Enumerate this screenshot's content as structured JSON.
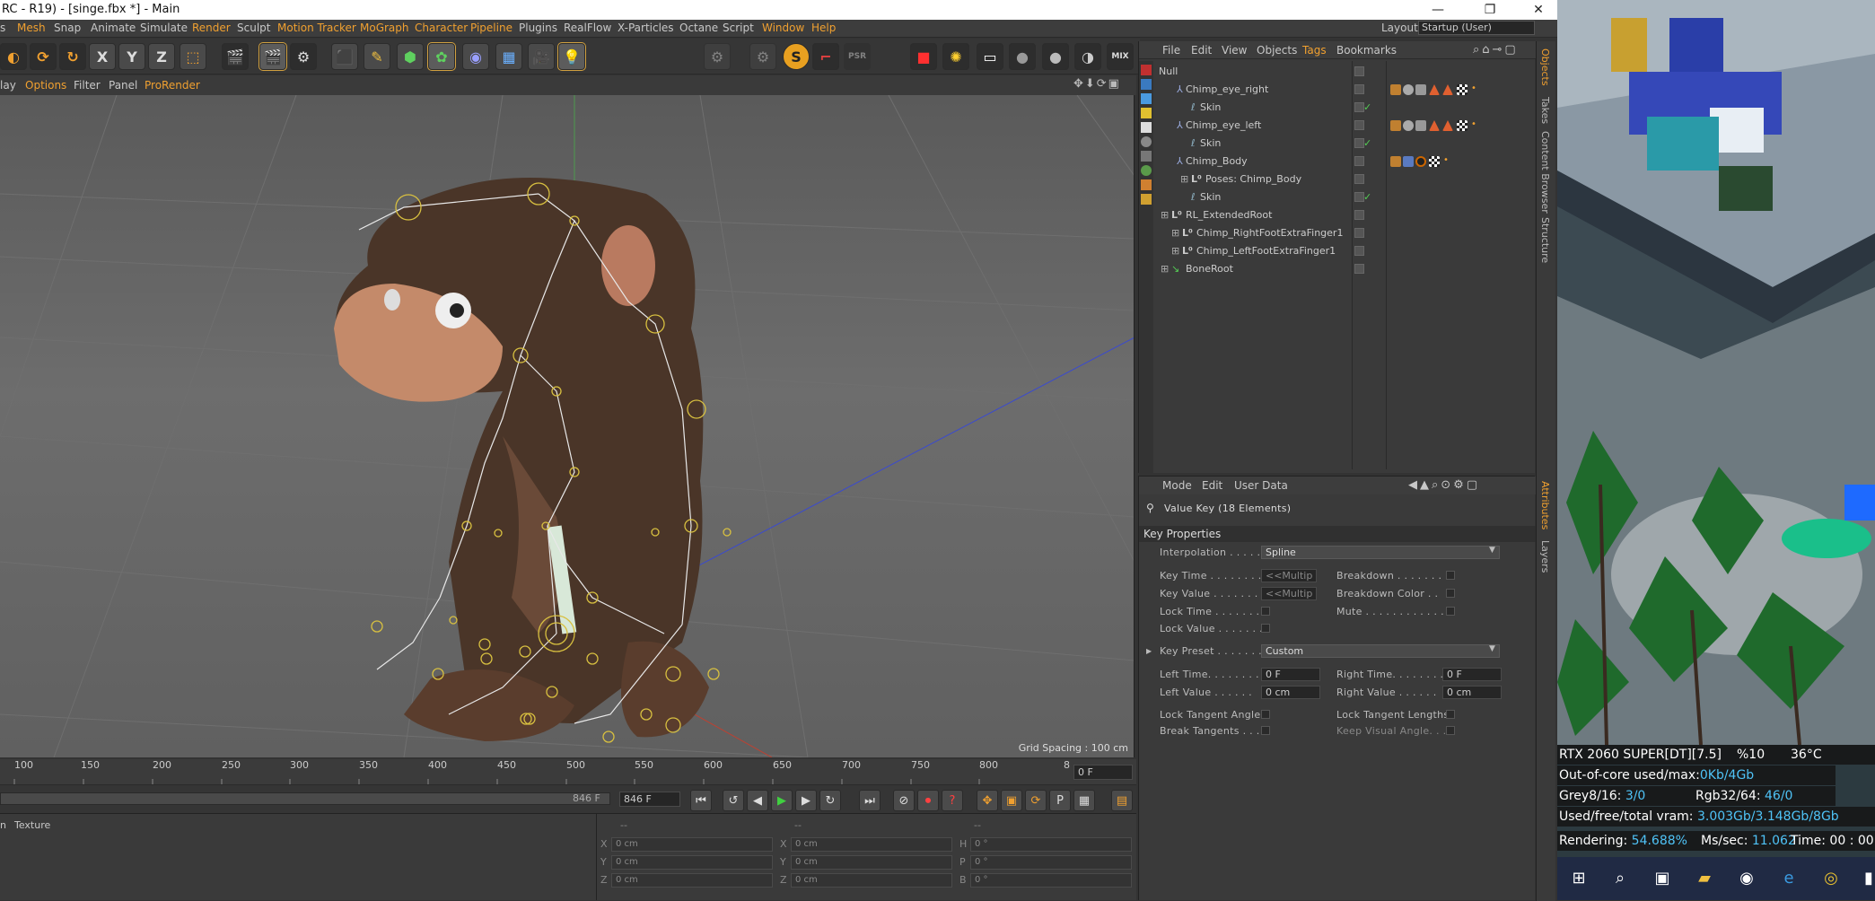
{
  "window": {
    "title": "RC - R19) - [singe.fbx *] - Main"
  },
  "menubar": {
    "items": [
      "s",
      "Mesh",
      "Snap",
      "Animate",
      "Simulate",
      "Render",
      "Sculpt",
      "Motion Tracker",
      "MoGraph",
      "Character",
      "Pipeline",
      "Plugins",
      "RealFlow",
      "X-Particles",
      "Octane",
      "Script",
      "Window",
      "Help"
    ],
    "layout_label": "Layout:",
    "layout_value": "Startup (User)"
  },
  "toolbar": {
    "axis_x": "X",
    "axis_y": "Y",
    "axis_z": "Z",
    "octane_s": "S",
    "mix_label": "MIX",
    "psr_label": "PSR"
  },
  "viewport": {
    "menu": [
      "lay",
      "Options",
      "Filter",
      "Panel",
      "ProRender"
    ],
    "grid_spacing": "Grid Spacing : 100 cm"
  },
  "timeline": {
    "ticks": [
      "100",
      "150",
      "200",
      "250",
      "300",
      "350",
      "400",
      "450",
      "500",
      "550",
      "600",
      "650",
      "700",
      "750",
      "800",
      "8"
    ],
    "frame_field": "0 F",
    "end_frame_a": "846 F",
    "end_frame_b": "846 F"
  },
  "material": {
    "tabs": [
      "n",
      "Texture"
    ]
  },
  "coords": {
    "headers": [
      "--",
      "--",
      "--"
    ],
    "rows": [
      {
        "a_label": "X",
        "a_val": "0 cm",
        "b_label": "X",
        "b_val": "0 cm",
        "c_label": "H",
        "c_val": "0 °"
      },
      {
        "a_label": "Y",
        "a_val": "0 cm",
        "b_label": "Y",
        "b_val": "0 cm",
        "c_label": "P",
        "c_val": "0 °"
      },
      {
        "a_label": "Z",
        "a_val": "0 cm",
        "b_label": "Z",
        "b_val": "0 cm",
        "c_label": "B",
        "c_val": "0 °"
      }
    ]
  },
  "object_manager": {
    "menu": [
      "File",
      "Edit",
      "View",
      "Objects",
      "Tags",
      "Bookmarks"
    ],
    "rows": [
      {
        "name": "Null",
        "indent": 0
      },
      {
        "name": "Chimp_eye_right",
        "indent": 1
      },
      {
        "name": "Skin",
        "indent": 2
      },
      {
        "name": "Chimp_eye_left",
        "indent": 1
      },
      {
        "name": "Skin",
        "indent": 2
      },
      {
        "name": "Chimp_Body",
        "indent": 1
      },
      {
        "name": "Poses: Chimp_Body",
        "indent": 2
      },
      {
        "name": "Skin",
        "indent": 2
      },
      {
        "name": "RL_ExtendedRoot",
        "indent": 1
      },
      {
        "name": "Chimp_RightFootExtraFinger1",
        "indent": 2
      },
      {
        "name": "Chimp_LeftFootExtraFinger1",
        "indent": 2
      },
      {
        "name": "BoneRoot",
        "indent": 1
      }
    ]
  },
  "side_tabs": [
    "Objects",
    "Takes",
    "Content Browser",
    "Structure",
    "Attributes",
    "Layers"
  ],
  "attributes": {
    "menu": [
      "Mode",
      "Edit",
      "User Data"
    ],
    "title": "Value Key (18 Elements)",
    "section": "Key Properties",
    "interpolation_label": "Interpolation . . . . . .",
    "interpolation_value": "Spline",
    "key_time_label": "Key Time . . . . . . . . .",
    "key_time_value": "<<Multip",
    "key_value_label": "Key Value . . . . . . . .",
    "key_value_value": "<<Multip",
    "lock_time_label": "Lock Time . . . . . . . .",
    "lock_value_label": "Lock Value . . . . . . .",
    "breakdown_label": "Breakdown . . . . . . .",
    "breakdown_color_label": "Breakdown Color . .",
    "mute_label": "Mute . . . . . . . . . . . .",
    "key_preset_label": "Key Preset . . . . . . .",
    "key_preset_value": "Custom",
    "left_time_label": "Left  Time. . . . . . . .",
    "left_time_value": "0 F",
    "left_value_label": "Left  Value . . . . . .",
    "left_value_value": "0 cm",
    "right_time_label": "Right Time. . . . . . . .",
    "right_time_value": "0 F",
    "right_value_label": "Right Value . . . . . .",
    "right_value_value": "0 cm",
    "lock_tangent_angles": "Lock Tangent Angles",
    "lock_tangent_lengths": "Lock Tangent Lengths",
    "break_tangents": "Break Tangents . . . .",
    "keep_visual_angle": "Keep Visual Angle. . ."
  },
  "render_stats": {
    "gpu": "RTX 2060 SUPER[DT][7.5]",
    "gpu_pct": "%10",
    "gpu_temp": "36°C",
    "ooc_label": "Out-of-core used/max:",
    "ooc_value": "0Kb/4Gb",
    "grey_label": "Grey8/16: ",
    "grey_value": "3/0",
    "rgb_label": "Rgb32/64: ",
    "rgb_value": "46/0",
    "vram_label": "Used/free/total vram: ",
    "vram_value": "3.003Gb/3.148Gb/8Gb",
    "rendering_label": "Rendering: ",
    "rendering_value": "54.688%",
    "ms_label": "Ms/sec: ",
    "ms_value": "11.062",
    "time_label": "Time: 00 : 00"
  },
  "colors": {
    "accent": "#f0a030",
    "stat_value": "#4fc3f7"
  }
}
